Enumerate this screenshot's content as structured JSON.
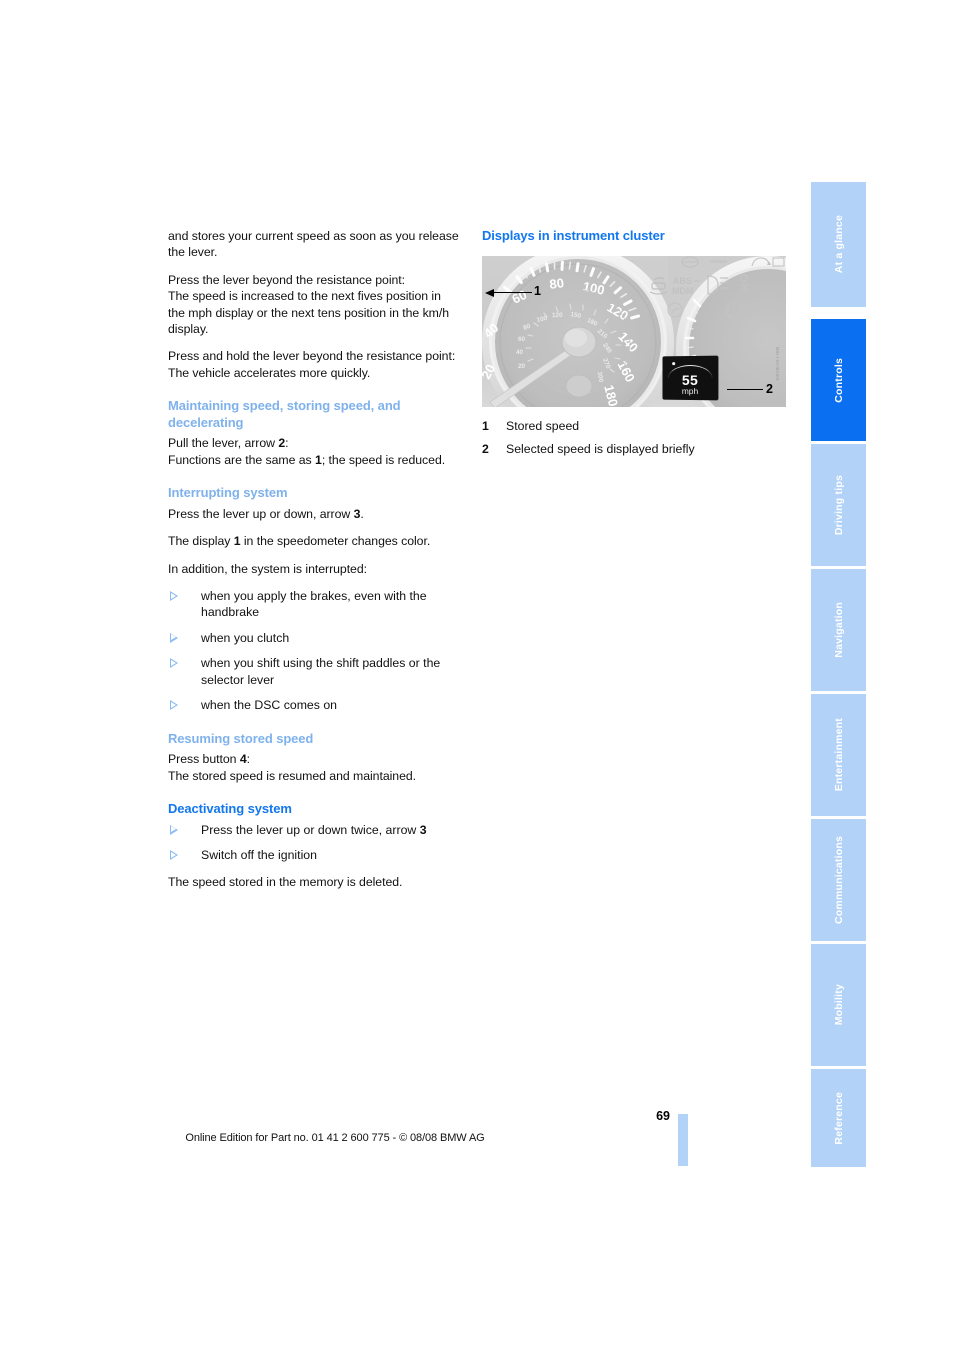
{
  "document": {
    "page_number": "69",
    "footer_note": "Online Edition for Part no. 01 41 2 600 775 - © 08/08 BMW AG"
  },
  "colors": {
    "heading_light": "#7fb2ec",
    "heading_strong": "#1277ef",
    "tab_inactive": "#b3d2f7",
    "tab_active": "#0a6ff0",
    "bullet": "#8cbcf2"
  },
  "left_column": {
    "intro_paragraph": "and stores your current speed as soon as you release the lever.",
    "paragraph_resistance_1_line1": "Press the lever beyond the resistance point:",
    "paragraph_resistance_1_line2": "The speed is increased to the next fives position in the mph display or the next tens position in the km/h display.",
    "paragraph_resistance_2_line1": "Press and hold the lever beyond the resistance point:",
    "paragraph_resistance_2_line2": "The vehicle accelerates more quickly.",
    "section_maintaining": {
      "heading": "Maintaining speed, storing speed, and decelerating",
      "line1_pre": "Pull the lever, arrow ",
      "line1_bold": "2",
      "line1_post": ":",
      "line2_pre": "Functions are the same as ",
      "line2_bold": "1",
      "line2_post": "; the speed is reduced."
    },
    "section_interrupting": {
      "heading": "Interrupting system",
      "line1_pre": "Press the lever up or down, arrow ",
      "line1_bold": "3",
      "line1_post": ".",
      "line2_pre": "The display ",
      "line2_bold": "1",
      "line2_post": " in the speedometer changes color.",
      "line3": "In addition, the system is interrupted:",
      "bullets": [
        "when you apply the brakes, even with the handbrake",
        "when you clutch",
        "when you shift using the shift paddles or the selector lever",
        "when the DSC comes on"
      ]
    },
    "section_resuming": {
      "heading": "Resuming stored speed",
      "line1_pre": "Press button ",
      "line1_bold": "4",
      "line1_post": ":",
      "line2": "The stored speed is resumed and maintained."
    },
    "section_deactivating": {
      "heading": "Deactivating system",
      "bullets": [
        {
          "pre": "Press the lever up or down twice, arrow ",
          "bold": "3",
          "post": ""
        },
        {
          "pre": "Switch off the ignition",
          "bold": "",
          "post": ""
        }
      ],
      "closing": "The speed stored in the memory is deleted."
    }
  },
  "right_column": {
    "heading": "Displays in instrument cluster",
    "figure": {
      "alt_name": "instrument-cluster-photo",
      "callout_1": "1",
      "callout_2": "2",
      "speedo_mph_ticks": [
        "20",
        "40",
        "60",
        "80",
        "100",
        "120",
        "140",
        "160",
        "180"
      ],
      "speedo_kmh_ticks": [
        "60",
        "80",
        "100",
        "120",
        "150",
        "180",
        "210",
        "240",
        "270",
        "300",
        "320"
      ],
      "display_value": "55",
      "display_unit": "mph",
      "credit": "MIN-I-DV-BASIS"
    },
    "legend": [
      {
        "num": "1",
        "text": "Stored speed"
      },
      {
        "num": "2",
        "text": "Selected speed is displayed briefly"
      }
    ]
  },
  "index_tabs": [
    {
      "label": "At a glance",
      "active": false
    },
    {
      "label": "Controls",
      "active": true
    },
    {
      "label": "Driving tips",
      "active": false
    },
    {
      "label": "Navigation",
      "active": false
    },
    {
      "label": "Entertainment",
      "active": false
    },
    {
      "label": "Communications",
      "active": false
    },
    {
      "label": "Mobility",
      "active": false
    },
    {
      "label": "Reference",
      "active": false
    }
  ]
}
